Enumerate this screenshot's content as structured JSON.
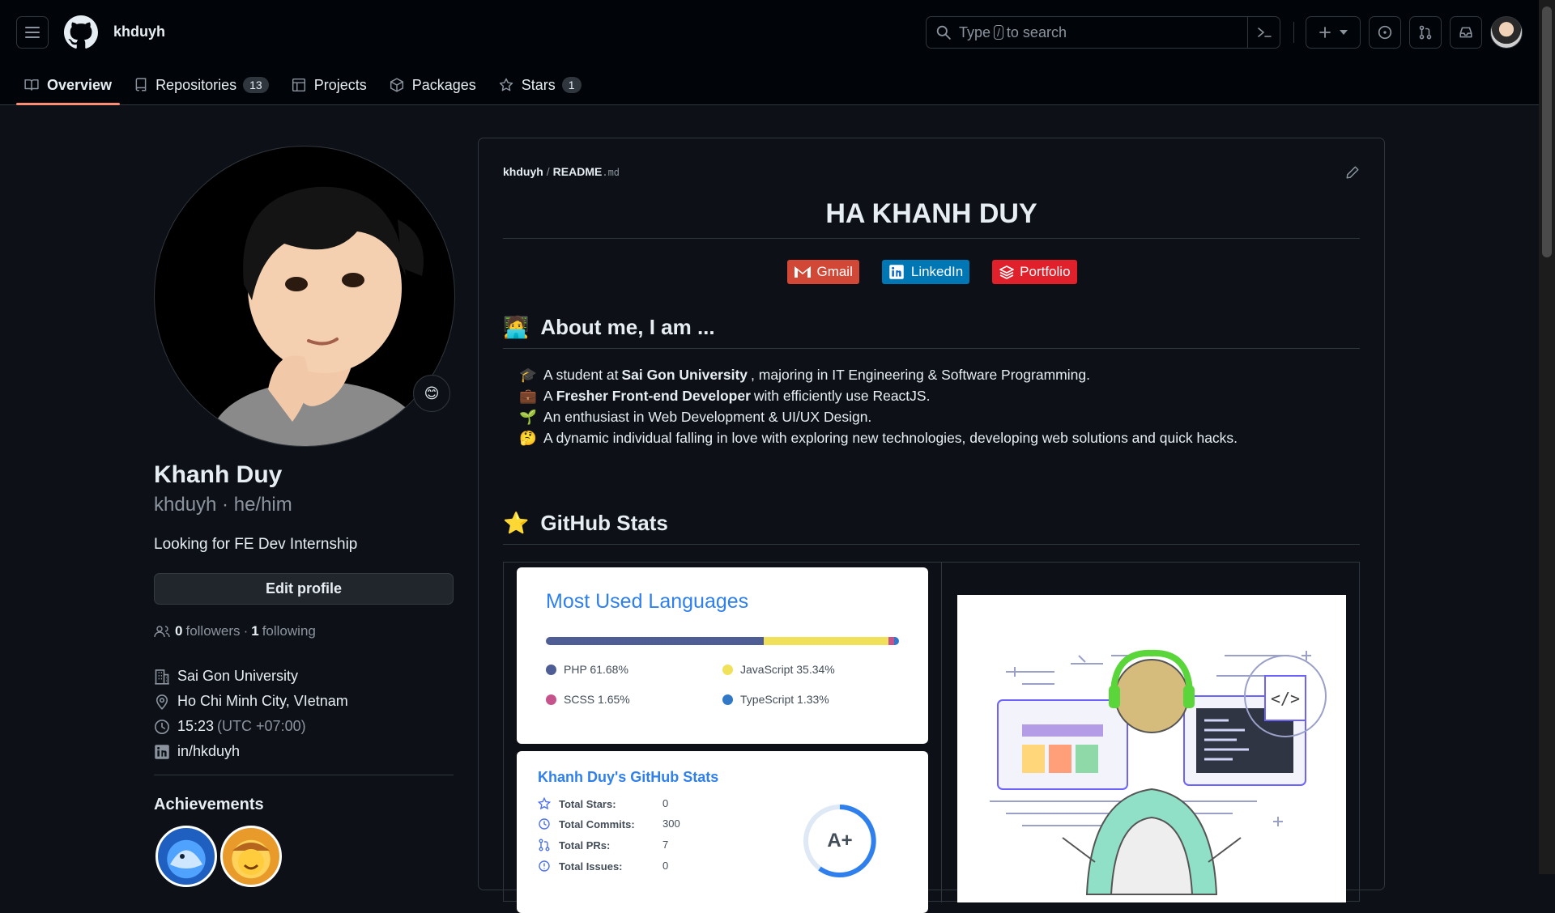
{
  "header": {
    "username": "khduyh",
    "search_prefix": "Type",
    "search_key": "/",
    "search_suffix": "to search"
  },
  "nav": {
    "tabs": [
      {
        "label": "Overview",
        "icon": "book-icon",
        "active": true
      },
      {
        "label": "Repositories",
        "icon": "repo-icon",
        "count": "13"
      },
      {
        "label": "Projects",
        "icon": "table-icon"
      },
      {
        "label": "Packages",
        "icon": "package-icon"
      },
      {
        "label": "Stars",
        "icon": "star-icon",
        "count": "1"
      }
    ]
  },
  "profile": {
    "name": "Khanh Duy",
    "login_line": "khduyh · he/him",
    "bio": "Looking for FE Dev Internship",
    "edit_label": "Edit profile",
    "followers_count": "0",
    "followers_label": "followers",
    "dot": "·",
    "following_count": "1",
    "following_label": "following",
    "organization": "Sai Gon University",
    "location": "Ho Chi Minh City, VIetnam",
    "time": "15:23",
    "timezone": "(UTC +07:00)",
    "linkedin": "in/hkduyh",
    "achievements_label": "Achievements",
    "status_emoji": "😊"
  },
  "readme": {
    "path_user": "khduyh",
    "path_sep": "/",
    "path_file": "README",
    "path_ext": ".md",
    "title": "HA KHANH DUY",
    "links": [
      {
        "label": "Gmail",
        "color": "#d14836"
      },
      {
        "label": "LinkedIn",
        "color": "#0077b5"
      },
      {
        "label": "Portfolio",
        "color": "#e0202a"
      }
    ],
    "about_heading": "About me, I am ...",
    "about_emoji": "🧑‍💻",
    "about": [
      {
        "emoji": "🎓",
        "parts": [
          "A student at ",
          "Sai Gon University",
          ", majoring in IT Engineering & Software Programming."
        ]
      },
      {
        "emoji": "💼",
        "parts": [
          "A ",
          "Fresher Front-end Developer",
          " with efficiently use ReactJS."
        ]
      },
      {
        "emoji": "🌱",
        "parts": [
          "An enthusiast in Web Development & UI/UX Design.",
          "",
          ""
        ]
      },
      {
        "emoji": "🤔",
        "parts": [
          "A dynamic individual falling in love with exploring new technologies, developing web solutions and quick hacks.",
          "",
          ""
        ]
      }
    ],
    "stats_heading": "GitHub Stats",
    "stats_emoji": "⭐"
  },
  "languages_card": {
    "title": "Most Used Languages",
    "langs": [
      {
        "label": "PHP 61.68%",
        "percent": 61.68,
        "color": "#4f5d95"
      },
      {
        "label": "JavaScript 35.34%",
        "percent": 35.34,
        "color": "#f1e05a"
      },
      {
        "label": "SCSS 1.65%",
        "percent": 1.65,
        "color": "#c6538c"
      },
      {
        "label": "TypeScript 1.33%",
        "percent": 1.33,
        "color": "#3178c6"
      }
    ]
  },
  "stats_card": {
    "title": "Khanh Duy's GitHub Stats",
    "rows": [
      {
        "label": "Total Stars:",
        "value": "0"
      },
      {
        "label": "Total Commits:",
        "value": "300"
      },
      {
        "label": "Total PRs:",
        "value": "7"
      },
      {
        "label": "Total Issues:",
        "value": "0"
      }
    ],
    "rank": "A+"
  }
}
